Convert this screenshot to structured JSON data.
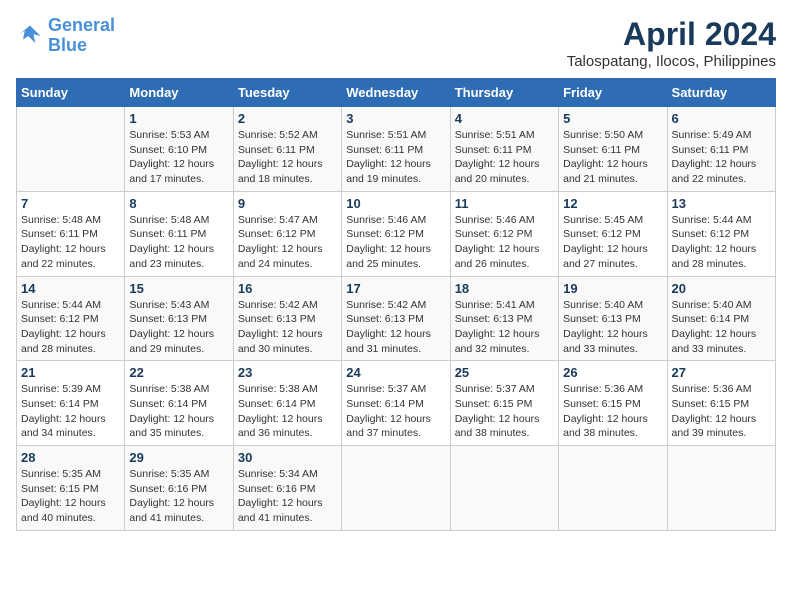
{
  "header": {
    "logo_line1": "General",
    "logo_line2": "Blue",
    "title": "April 2024",
    "subtitle": "Talospatang, Ilocos, Philippines"
  },
  "days_of_week": [
    "Sunday",
    "Monday",
    "Tuesday",
    "Wednesday",
    "Thursday",
    "Friday",
    "Saturday"
  ],
  "weeks": [
    [
      {
        "day": "",
        "info": ""
      },
      {
        "day": "1",
        "info": "Sunrise: 5:53 AM\nSunset: 6:10 PM\nDaylight: 12 hours\nand 17 minutes."
      },
      {
        "day": "2",
        "info": "Sunrise: 5:52 AM\nSunset: 6:11 PM\nDaylight: 12 hours\nand 18 minutes."
      },
      {
        "day": "3",
        "info": "Sunrise: 5:51 AM\nSunset: 6:11 PM\nDaylight: 12 hours\nand 19 minutes."
      },
      {
        "day": "4",
        "info": "Sunrise: 5:51 AM\nSunset: 6:11 PM\nDaylight: 12 hours\nand 20 minutes."
      },
      {
        "day": "5",
        "info": "Sunrise: 5:50 AM\nSunset: 6:11 PM\nDaylight: 12 hours\nand 21 minutes."
      },
      {
        "day": "6",
        "info": "Sunrise: 5:49 AM\nSunset: 6:11 PM\nDaylight: 12 hours\nand 22 minutes."
      }
    ],
    [
      {
        "day": "7",
        "info": "Sunrise: 5:48 AM\nSunset: 6:11 PM\nDaylight: 12 hours\nand 22 minutes."
      },
      {
        "day": "8",
        "info": "Sunrise: 5:48 AM\nSunset: 6:11 PM\nDaylight: 12 hours\nand 23 minutes."
      },
      {
        "day": "9",
        "info": "Sunrise: 5:47 AM\nSunset: 6:12 PM\nDaylight: 12 hours\nand 24 minutes."
      },
      {
        "day": "10",
        "info": "Sunrise: 5:46 AM\nSunset: 6:12 PM\nDaylight: 12 hours\nand 25 minutes."
      },
      {
        "day": "11",
        "info": "Sunrise: 5:46 AM\nSunset: 6:12 PM\nDaylight: 12 hours\nand 26 minutes."
      },
      {
        "day": "12",
        "info": "Sunrise: 5:45 AM\nSunset: 6:12 PM\nDaylight: 12 hours\nand 27 minutes."
      },
      {
        "day": "13",
        "info": "Sunrise: 5:44 AM\nSunset: 6:12 PM\nDaylight: 12 hours\nand 28 minutes."
      }
    ],
    [
      {
        "day": "14",
        "info": "Sunrise: 5:44 AM\nSunset: 6:12 PM\nDaylight: 12 hours\nand 28 minutes."
      },
      {
        "day": "15",
        "info": "Sunrise: 5:43 AM\nSunset: 6:13 PM\nDaylight: 12 hours\nand 29 minutes."
      },
      {
        "day": "16",
        "info": "Sunrise: 5:42 AM\nSunset: 6:13 PM\nDaylight: 12 hours\nand 30 minutes."
      },
      {
        "day": "17",
        "info": "Sunrise: 5:42 AM\nSunset: 6:13 PM\nDaylight: 12 hours\nand 31 minutes."
      },
      {
        "day": "18",
        "info": "Sunrise: 5:41 AM\nSunset: 6:13 PM\nDaylight: 12 hours\nand 32 minutes."
      },
      {
        "day": "19",
        "info": "Sunrise: 5:40 AM\nSunset: 6:13 PM\nDaylight: 12 hours\nand 33 minutes."
      },
      {
        "day": "20",
        "info": "Sunrise: 5:40 AM\nSunset: 6:14 PM\nDaylight: 12 hours\nand 33 minutes."
      }
    ],
    [
      {
        "day": "21",
        "info": "Sunrise: 5:39 AM\nSunset: 6:14 PM\nDaylight: 12 hours\nand 34 minutes."
      },
      {
        "day": "22",
        "info": "Sunrise: 5:38 AM\nSunset: 6:14 PM\nDaylight: 12 hours\nand 35 minutes."
      },
      {
        "day": "23",
        "info": "Sunrise: 5:38 AM\nSunset: 6:14 PM\nDaylight: 12 hours\nand 36 minutes."
      },
      {
        "day": "24",
        "info": "Sunrise: 5:37 AM\nSunset: 6:14 PM\nDaylight: 12 hours\nand 37 minutes."
      },
      {
        "day": "25",
        "info": "Sunrise: 5:37 AM\nSunset: 6:15 PM\nDaylight: 12 hours\nand 38 minutes."
      },
      {
        "day": "26",
        "info": "Sunrise: 5:36 AM\nSunset: 6:15 PM\nDaylight: 12 hours\nand 38 minutes."
      },
      {
        "day": "27",
        "info": "Sunrise: 5:36 AM\nSunset: 6:15 PM\nDaylight: 12 hours\nand 39 minutes."
      }
    ],
    [
      {
        "day": "28",
        "info": "Sunrise: 5:35 AM\nSunset: 6:15 PM\nDaylight: 12 hours\nand 40 minutes."
      },
      {
        "day": "29",
        "info": "Sunrise: 5:35 AM\nSunset: 6:16 PM\nDaylight: 12 hours\nand 41 minutes."
      },
      {
        "day": "30",
        "info": "Sunrise: 5:34 AM\nSunset: 6:16 PM\nDaylight: 12 hours\nand 41 minutes."
      },
      {
        "day": "",
        "info": ""
      },
      {
        "day": "",
        "info": ""
      },
      {
        "day": "",
        "info": ""
      },
      {
        "day": "",
        "info": ""
      }
    ]
  ]
}
